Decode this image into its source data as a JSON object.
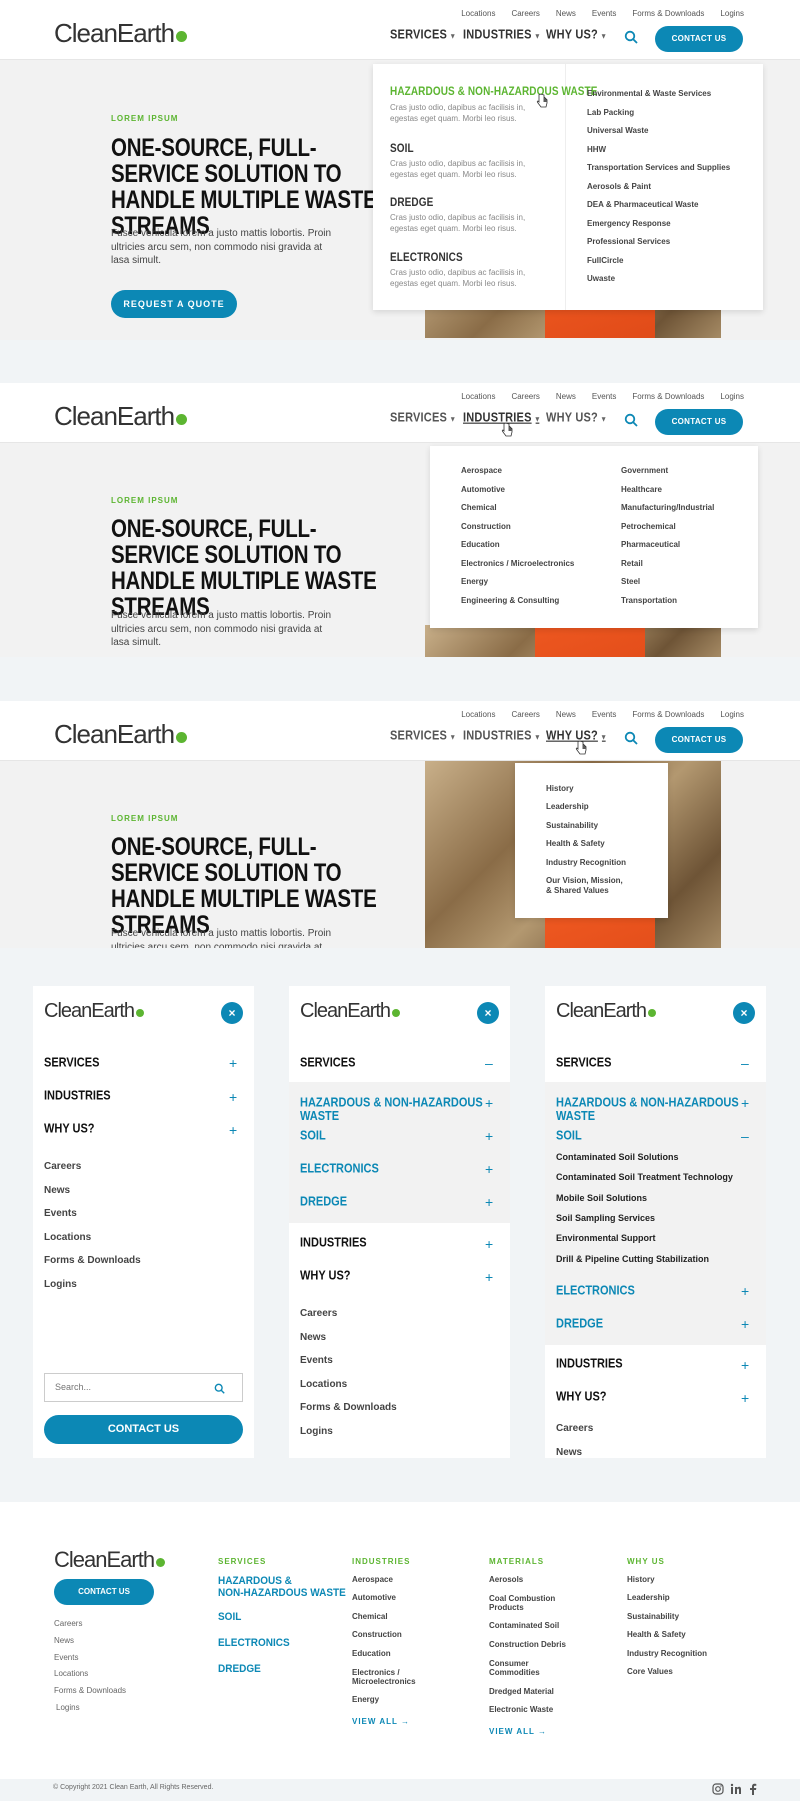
{
  "brand": {
    "logo": "CleanEarth",
    "accent": "#0c88b5",
    "green": "#5cb531"
  },
  "utility": [
    "Locations",
    "Careers",
    "News",
    "Events",
    "Forms & Downloads",
    "Logins"
  ],
  "nav": {
    "services": "SERVICES",
    "industries": "INDUSTRIES",
    "whyus": "WHY US?",
    "contact": "CONTACT US"
  },
  "hero": {
    "eyebrow": "LOREM IPSUM",
    "headline": "ONE-SOURCE, FULL-SERVICE SOLUTION TO HANDLE MULTIPLE WASTE STREAMS",
    "body": "Fusce vehicula lorem a justo mattis lobortis. Proin ultricies arcu sem, non commodo nisi gravida at lasa simult.",
    "cta": "REQUEST A QUOTE"
  },
  "services_menu": {
    "groups": [
      {
        "title": "HAZARDOUS & NON-HAZARDOUS WASTE",
        "desc": "Cras justo odio, dapibus ac facilisis in, egestas eget quam. Morbi leo risus."
      },
      {
        "title": "SOIL",
        "desc": "Cras justo odio, dapibus ac facilisis in, egestas eget quam. Morbi leo risus."
      },
      {
        "title": "DREDGE",
        "desc": "Cras justo odio, dapibus ac facilisis in, egestas eget quam. Morbi leo risus."
      },
      {
        "title": "ELECTRONICS",
        "desc": "Cras justo odio, dapibus ac facilisis in, egestas eget quam. Morbi leo risus."
      }
    ],
    "links": [
      "Environmental & Waste Services",
      "Lab Packing",
      "Universal Waste",
      "HHW",
      "Transportation Services and Supplies",
      "Aerosols & Paint",
      "DEA & Pharmaceutical Waste",
      "Emergency Response",
      "Professional Services",
      "FullCircle",
      "Uwaste"
    ]
  },
  "industries_menu": {
    "col1": [
      "Aerospace",
      "Automotive",
      "Chemical",
      "Construction",
      "Education",
      "Electronics / Microelectronics",
      "Energy",
      "Engineering & Consulting"
    ],
    "col2": [
      "Government",
      "Healthcare",
      "Manufacturing/Industrial",
      "Petrochemical",
      "Pharmaceutical",
      "Retail",
      "Steel",
      "Transportation"
    ]
  },
  "whyus_menu": [
    "History",
    "Leadership",
    "Sustainability",
    "Health & Safety",
    "Industry Recognition",
    "Our Vision, Mission,",
    "& Shared Values"
  ],
  "mobile": {
    "sections": [
      "SERVICES",
      "INDUSTRIES",
      "WHY US?"
    ],
    "links": [
      "Careers",
      "News",
      "Events",
      "Locations",
      "Forms & Downloads",
      "Logins"
    ],
    "search_placeholder": "Search...",
    "contact": "CONTACT US",
    "service_subs": [
      "HAZARDOUS & NON-HAZARDOUS WASTE",
      "SOIL",
      "ELECTRONICS",
      "DREDGE"
    ],
    "soil_items": [
      "Contaminated Soil Solutions",
      "Contaminated Soil Treatment Technology",
      "Mobile Soil Solutions",
      "Soil Sampling Services",
      "Environmental Support",
      "Drill & Pipeline Cutting Stabilization"
    ],
    "plus": "+",
    "minus": "–",
    "close": "×"
  },
  "footer": {
    "contact": "CONTACT US",
    "links": [
      "Careers",
      "News",
      "Events",
      "Locations",
      "Forms & Downloads",
      "Logins"
    ],
    "services": {
      "head": "SERVICES",
      "items": [
        "HAZARDOUS &",
        "NON-HAZARDOUS WASTE",
        "SOIL",
        "ELECTRONICS",
        "DREDGE"
      ]
    },
    "industries": {
      "head": "INDUSTRIES",
      "items": [
        "Aerospace",
        "Automotive",
        "Chemical",
        "Construction",
        "Education",
        "Electronics /",
        "Microelectronics",
        "Energy"
      ],
      "view": "VIEW ALL →"
    },
    "materials": {
      "head": "MATERIALS",
      "items": [
        "Aerosols",
        "Coal Combustion",
        "Products",
        "Contaminated Soil",
        "Construction Debris",
        "Consumer",
        "Commodities",
        "Dredged Material",
        "Electronic Waste"
      ],
      "view": "VIEW ALL →"
    },
    "whyus": {
      "head": "WHY US",
      "items": [
        "History",
        "Leadership",
        "Sustainability",
        "Health & Safety",
        "Industry Recognition",
        "Core Values"
      ]
    },
    "copyright": "© Copyright 2021 Clean Earth, All Rights Reserved.",
    "social": [
      "instagram-icon",
      "linkedin-icon",
      "facebook-icon"
    ]
  }
}
